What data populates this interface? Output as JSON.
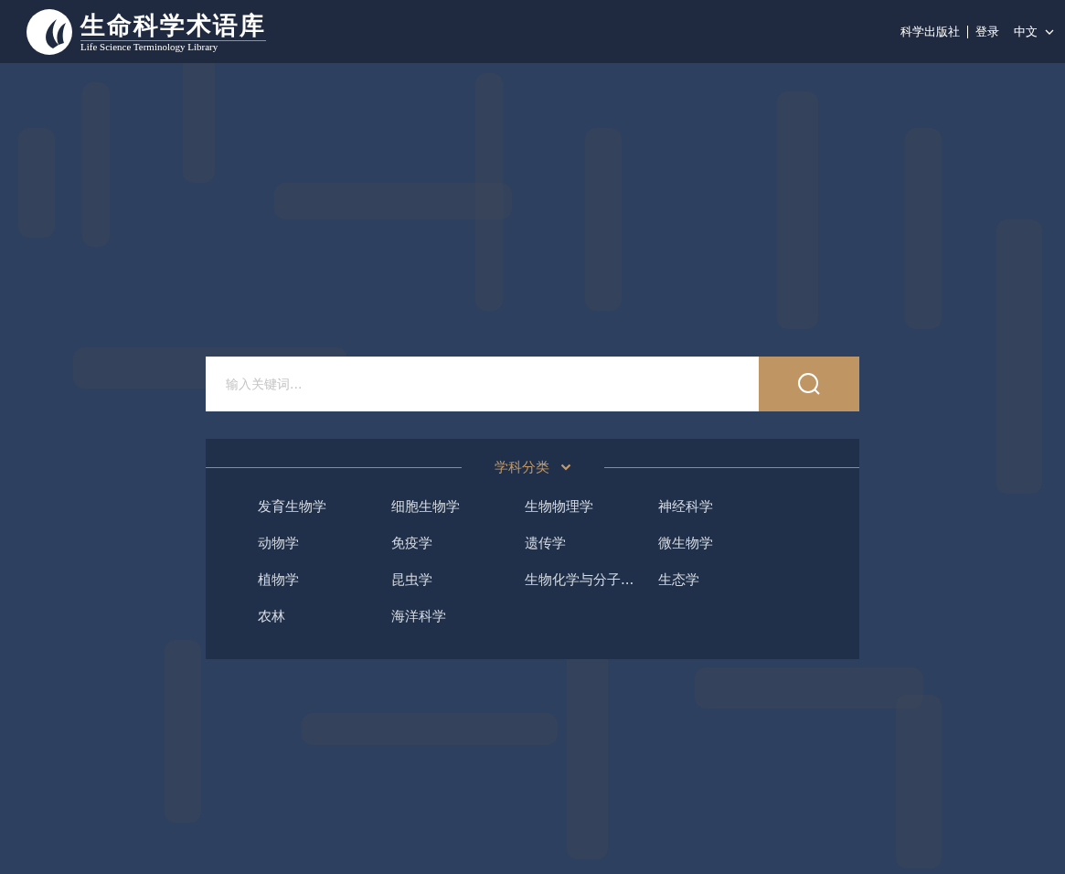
{
  "header": {
    "logo_title": "生命科学术语库",
    "logo_subtitle": "Life Science Terminology Library",
    "links": [
      {
        "label": "科学出版社"
      },
      {
        "label": "登录"
      }
    ],
    "language": "中文"
  },
  "search": {
    "placeholder": "输入关键词..."
  },
  "categories": {
    "title": "学科分类",
    "expanded": true,
    "items": [
      {
        "label": "发育生物学"
      },
      {
        "label": "细胞生物学"
      },
      {
        "label": "生物物理学"
      },
      {
        "label": "神经科学"
      },
      {
        "label": "动物学"
      },
      {
        "label": "免疫学"
      },
      {
        "label": "遗传学"
      },
      {
        "label": "微生物学"
      },
      {
        "label": "植物学"
      },
      {
        "label": "昆虫学"
      },
      {
        "label": "生物化学与分子..."
      },
      {
        "label": "生态学"
      },
      {
        "label": "农林"
      },
      {
        "label": "海洋科学"
      }
    ]
  }
}
